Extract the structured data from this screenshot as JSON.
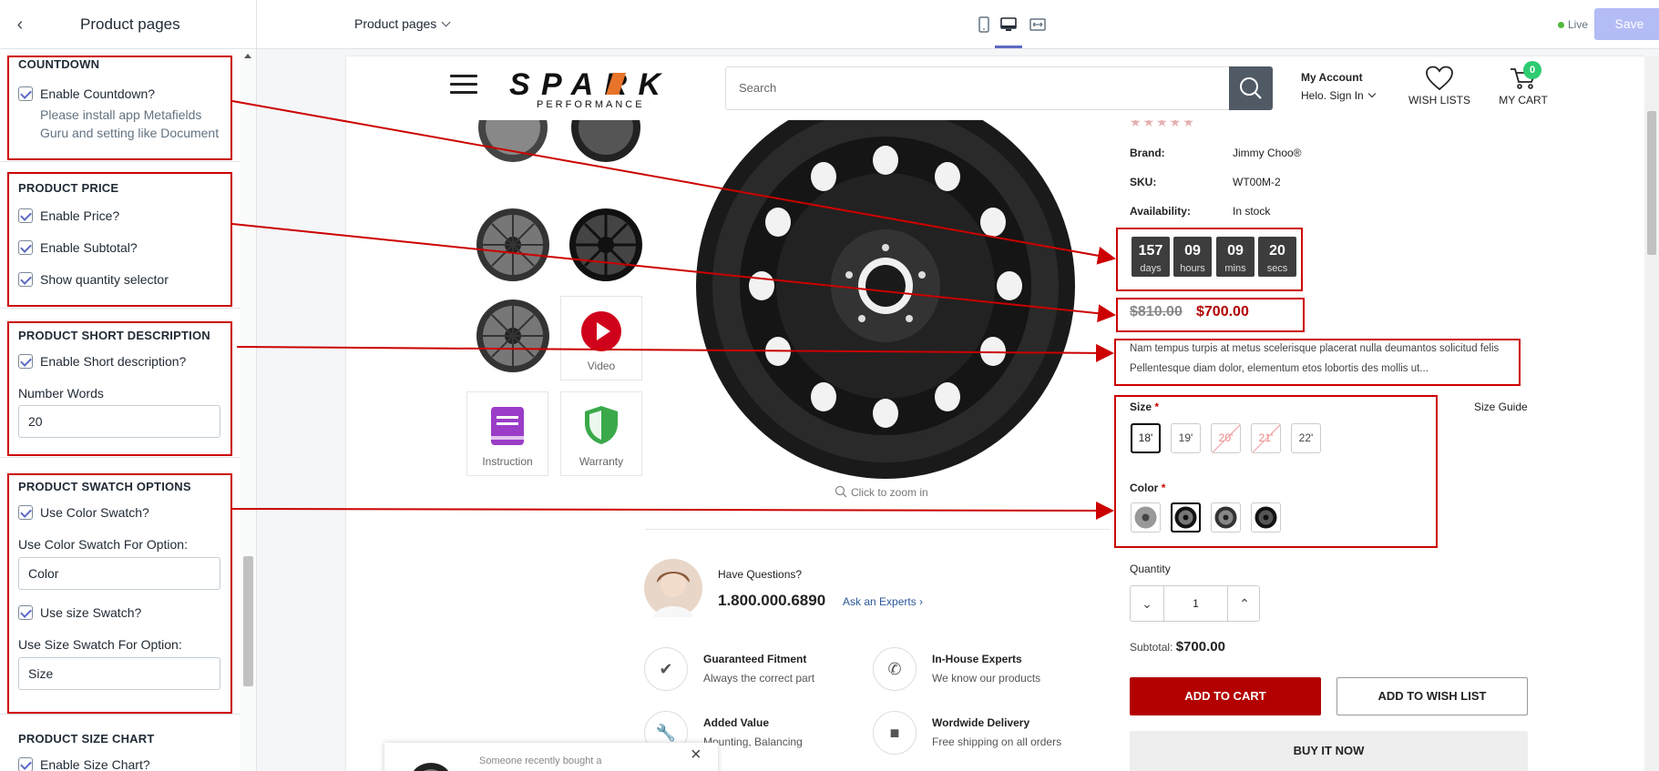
{
  "sidebar": {
    "title": "Product pages",
    "countdown": {
      "title": "COUNTDOWN",
      "enable_label": "Enable Countdown?",
      "help_1": "Please install app Metafields",
      "help_2": "Guru and setting like Document"
    },
    "price": {
      "title": "PRODUCT PRICE",
      "enable_price": "Enable Price?",
      "enable_subtotal": "Enable Subtotal?",
      "show_qty": "Show quantity selector"
    },
    "short_desc": {
      "title": "PRODUCT SHORT DESCRIPTION",
      "enable_label": "Enable Short description?",
      "number_words_label": "Number Words",
      "number_words_value": "20"
    },
    "swatch": {
      "title": "PRODUCT SWATCH OPTIONS",
      "use_color": "Use Color Swatch?",
      "color_option_label": "Use Color Swatch For Option:",
      "color_option_value": "Color",
      "use_size": "Use size Swatch?",
      "size_option_label": "Use Size Swatch For Option:",
      "size_option_value": "Size"
    },
    "size_chart": {
      "title": "PRODUCT SIZE CHART",
      "enable_label": "Enable Size Chart?"
    }
  },
  "topbar": {
    "page_select": "Product pages",
    "live_label": "Live",
    "save_label": "Save"
  },
  "store": {
    "logo_top": "SPARK",
    "logo_bottom": "PERFORMANCE",
    "search_placeholder": "Search",
    "account_title": "My Account",
    "account_sub": "Helo. Sign In",
    "wishlist_label": "WISH LISTS",
    "cart_label": "MY CART",
    "cart_count": "0"
  },
  "gallery": {
    "video_label": "Video",
    "instruction_label": "Instruction",
    "warranty_label": "Warranty",
    "zoom_hint": "Click to zoom in"
  },
  "product": {
    "brand_key": "Brand:",
    "brand_val": "Jimmy Choo®",
    "sku_key": "SKU:",
    "sku_val": "WT00M-2",
    "avail_key": "Availability:",
    "avail_val": "In stock",
    "countdown": [
      {
        "value": "157",
        "unit": "days"
      },
      {
        "value": "09",
        "unit": "hours"
      },
      {
        "value": "09",
        "unit": "mins"
      },
      {
        "value": "20",
        "unit": "secs"
      }
    ],
    "price_old": "$810.00",
    "price_new": "$700.00",
    "desc_1": "Nam tempus turpis at metus scelerisque placerat nulla deumantos solicitud felis",
    "desc_2": "Pellentesque diam dolor, elementum etos lobortis des mollis ut...",
    "size_label": "Size",
    "size_guide": "Size Guide",
    "sizes": [
      "18'",
      "19'",
      "20'",
      "21'",
      "22'"
    ],
    "color_label": "Color",
    "quantity_label": "Quantity",
    "quantity_value": "1",
    "subtotal_label": "Subtotal:",
    "subtotal_value": "$700.00",
    "add_to_cart": "ADD TO CART",
    "add_to_wishlist": "ADD TO WISH LIST",
    "buy_now": "BUY IT NOW"
  },
  "support": {
    "have_questions": "Have Questions?",
    "phone": "1.800.000.6890",
    "ask_experts": "Ask an Experts",
    "features": [
      {
        "title": "Guaranteed Fitment",
        "sub": "Always the correct part"
      },
      {
        "title": "In-House Experts",
        "sub": "We know our products"
      },
      {
        "title": "Added Value",
        "sub": "Mounting, Balancing"
      },
      {
        "title": "Wordwide Delivery",
        "sub": "Free shipping on all orders"
      }
    ]
  },
  "popup": {
    "text": "Someone recently bought a"
  },
  "colors": {
    "accent": "#5c6ac4",
    "annotation": "#cc0000",
    "brand_red": "#b30000"
  }
}
